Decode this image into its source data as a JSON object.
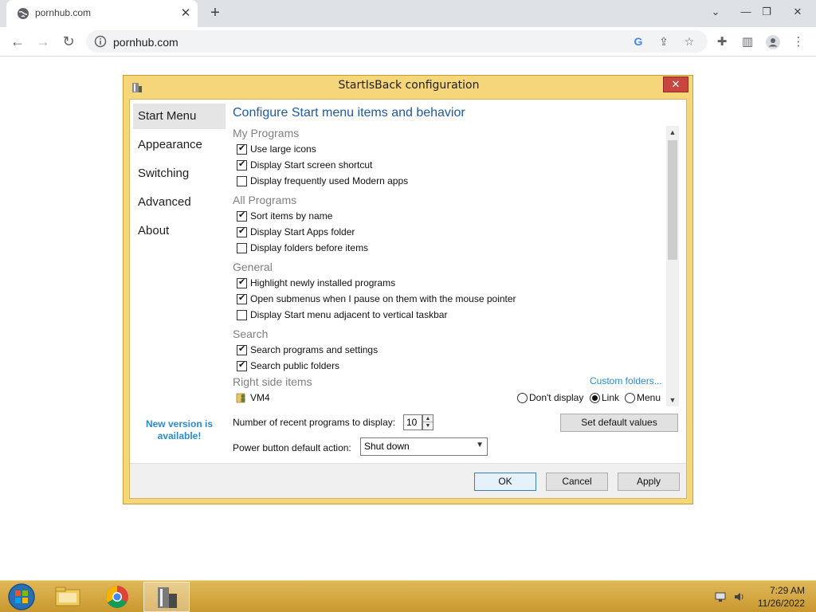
{
  "browser": {
    "tab_title": "pornhub.com",
    "url": "pornhub.com",
    "new_tab_label": "+",
    "tab_close_label": "✕"
  },
  "dialog": {
    "title": "StartIsBack configuration",
    "close_label": "✕",
    "sidebar": [
      {
        "label": "Start Menu",
        "selected": true
      },
      {
        "label": "Appearance",
        "selected": false
      },
      {
        "label": "Switching",
        "selected": false
      },
      {
        "label": "Advanced",
        "selected": false
      },
      {
        "label": "About",
        "selected": false
      }
    ],
    "new_version": "New version is available!",
    "heading": "Configure Start menu items and behavior",
    "sections": [
      {
        "title": "My Programs",
        "options": [
          {
            "label": "Use large icons",
            "checked": true
          },
          {
            "label": "Display Start screen shortcut",
            "checked": true
          },
          {
            "label": "Display frequently used Modern apps",
            "checked": false
          }
        ]
      },
      {
        "title": "All Programs",
        "options": [
          {
            "label": "Sort items by name",
            "checked": true
          },
          {
            "label": "Display Start Apps folder",
            "checked": true
          },
          {
            "label": "Display folders before items",
            "checked": false
          }
        ]
      },
      {
        "title": "General",
        "options": [
          {
            "label": "Highlight newly installed programs",
            "checked": true
          },
          {
            "label": "Open submenus when I pause on them with the mouse pointer",
            "checked": true
          },
          {
            "label": "Display Start menu adjacent to vertical taskbar",
            "checked": false
          }
        ]
      },
      {
        "title": "Search",
        "options": [
          {
            "label": "Search programs and settings",
            "checked": true
          },
          {
            "label": "Search public folders",
            "checked": true
          }
        ]
      }
    ],
    "right_side_title": "Right side items",
    "custom_folders": "Custom folders...",
    "right_item": {
      "label": "VM4",
      "choices": [
        {
          "label": "Don't display",
          "selected": false
        },
        {
          "label": "Link",
          "selected": true
        },
        {
          "label": "Menu",
          "selected": false
        }
      ]
    },
    "recent_label": "Number of recent programs to display:",
    "recent_value": "10",
    "set_default": "Set default values",
    "power_label": "Power button default action:",
    "power_value": "Shut down",
    "buttons": {
      "ok": "OK",
      "cancel": "Cancel",
      "apply": "Apply"
    }
  },
  "taskbar": {
    "time": "7:29 AM",
    "date": "11/26/2022"
  },
  "colors": {
    "dialog_frame": "#f6d67a",
    "accent_blue": "#1f5aa3",
    "link_blue": "#2a8bd2",
    "close_red": "#c7473e",
    "taskbar": "#c9982e"
  }
}
